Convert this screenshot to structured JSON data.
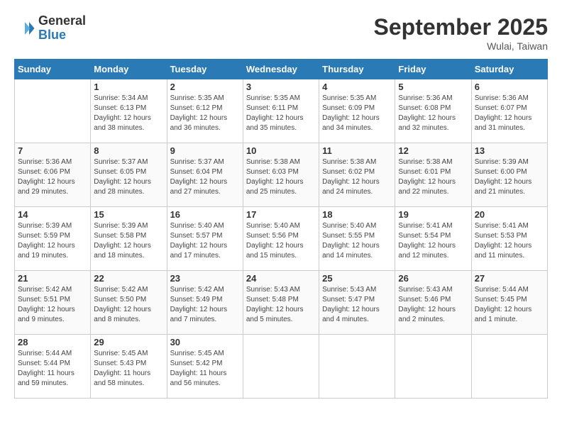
{
  "logo": {
    "line1": "General",
    "line2": "Blue"
  },
  "title": "September 2025",
  "location": "Wulai, Taiwan",
  "days_of_week": [
    "Sunday",
    "Monday",
    "Tuesday",
    "Wednesday",
    "Thursday",
    "Friday",
    "Saturday"
  ],
  "weeks": [
    [
      {
        "day": "",
        "info": ""
      },
      {
        "day": "1",
        "info": "Sunrise: 5:34 AM\nSunset: 6:13 PM\nDaylight: 12 hours\nand 38 minutes."
      },
      {
        "day": "2",
        "info": "Sunrise: 5:35 AM\nSunset: 6:12 PM\nDaylight: 12 hours\nand 36 minutes."
      },
      {
        "day": "3",
        "info": "Sunrise: 5:35 AM\nSunset: 6:11 PM\nDaylight: 12 hours\nand 35 minutes."
      },
      {
        "day": "4",
        "info": "Sunrise: 5:35 AM\nSunset: 6:09 PM\nDaylight: 12 hours\nand 34 minutes."
      },
      {
        "day": "5",
        "info": "Sunrise: 5:36 AM\nSunset: 6:08 PM\nDaylight: 12 hours\nand 32 minutes."
      },
      {
        "day": "6",
        "info": "Sunrise: 5:36 AM\nSunset: 6:07 PM\nDaylight: 12 hours\nand 31 minutes."
      }
    ],
    [
      {
        "day": "7",
        "info": "Sunrise: 5:36 AM\nSunset: 6:06 PM\nDaylight: 12 hours\nand 29 minutes."
      },
      {
        "day": "8",
        "info": "Sunrise: 5:37 AM\nSunset: 6:05 PM\nDaylight: 12 hours\nand 28 minutes."
      },
      {
        "day": "9",
        "info": "Sunrise: 5:37 AM\nSunset: 6:04 PM\nDaylight: 12 hours\nand 27 minutes."
      },
      {
        "day": "10",
        "info": "Sunrise: 5:38 AM\nSunset: 6:03 PM\nDaylight: 12 hours\nand 25 minutes."
      },
      {
        "day": "11",
        "info": "Sunrise: 5:38 AM\nSunset: 6:02 PM\nDaylight: 12 hours\nand 24 minutes."
      },
      {
        "day": "12",
        "info": "Sunrise: 5:38 AM\nSunset: 6:01 PM\nDaylight: 12 hours\nand 22 minutes."
      },
      {
        "day": "13",
        "info": "Sunrise: 5:39 AM\nSunset: 6:00 PM\nDaylight: 12 hours\nand 21 minutes."
      }
    ],
    [
      {
        "day": "14",
        "info": "Sunrise: 5:39 AM\nSunset: 5:59 PM\nDaylight: 12 hours\nand 19 minutes."
      },
      {
        "day": "15",
        "info": "Sunrise: 5:39 AM\nSunset: 5:58 PM\nDaylight: 12 hours\nand 18 minutes."
      },
      {
        "day": "16",
        "info": "Sunrise: 5:40 AM\nSunset: 5:57 PM\nDaylight: 12 hours\nand 17 minutes."
      },
      {
        "day": "17",
        "info": "Sunrise: 5:40 AM\nSunset: 5:56 PM\nDaylight: 12 hours\nand 15 minutes."
      },
      {
        "day": "18",
        "info": "Sunrise: 5:40 AM\nSunset: 5:55 PM\nDaylight: 12 hours\nand 14 minutes."
      },
      {
        "day": "19",
        "info": "Sunrise: 5:41 AM\nSunset: 5:54 PM\nDaylight: 12 hours\nand 12 minutes."
      },
      {
        "day": "20",
        "info": "Sunrise: 5:41 AM\nSunset: 5:53 PM\nDaylight: 12 hours\nand 11 minutes."
      }
    ],
    [
      {
        "day": "21",
        "info": "Sunrise: 5:42 AM\nSunset: 5:51 PM\nDaylight: 12 hours\nand 9 minutes."
      },
      {
        "day": "22",
        "info": "Sunrise: 5:42 AM\nSunset: 5:50 PM\nDaylight: 12 hours\nand 8 minutes."
      },
      {
        "day": "23",
        "info": "Sunrise: 5:42 AM\nSunset: 5:49 PM\nDaylight: 12 hours\nand 7 minutes."
      },
      {
        "day": "24",
        "info": "Sunrise: 5:43 AM\nSunset: 5:48 PM\nDaylight: 12 hours\nand 5 minutes."
      },
      {
        "day": "25",
        "info": "Sunrise: 5:43 AM\nSunset: 5:47 PM\nDaylight: 12 hours\nand 4 minutes."
      },
      {
        "day": "26",
        "info": "Sunrise: 5:43 AM\nSunset: 5:46 PM\nDaylight: 12 hours\nand 2 minutes."
      },
      {
        "day": "27",
        "info": "Sunrise: 5:44 AM\nSunset: 5:45 PM\nDaylight: 12 hours\nand 1 minute."
      }
    ],
    [
      {
        "day": "28",
        "info": "Sunrise: 5:44 AM\nSunset: 5:44 PM\nDaylight: 11 hours\nand 59 minutes."
      },
      {
        "day": "29",
        "info": "Sunrise: 5:45 AM\nSunset: 5:43 PM\nDaylight: 11 hours\nand 58 minutes."
      },
      {
        "day": "30",
        "info": "Sunrise: 5:45 AM\nSunset: 5:42 PM\nDaylight: 11 hours\nand 56 minutes."
      },
      {
        "day": "",
        "info": ""
      },
      {
        "day": "",
        "info": ""
      },
      {
        "day": "",
        "info": ""
      },
      {
        "day": "",
        "info": ""
      }
    ]
  ]
}
